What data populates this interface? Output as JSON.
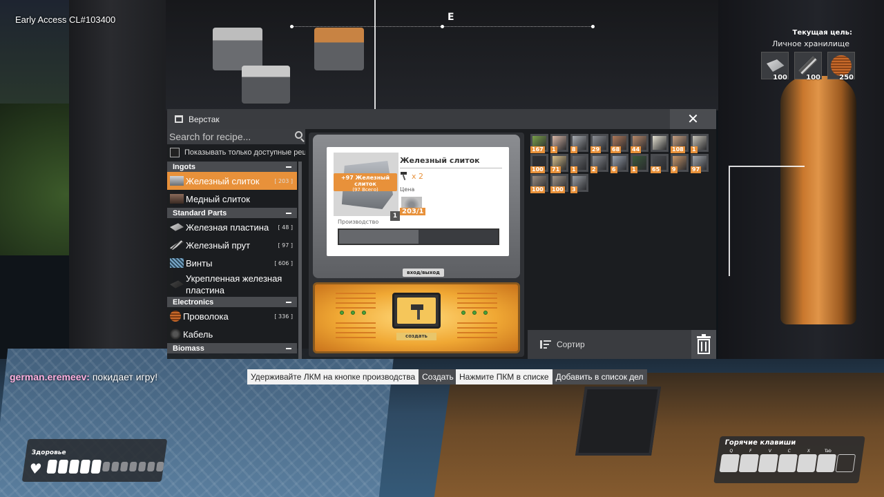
{
  "hud": {
    "build_label": "Early Access CL#103400",
    "compass_letter": "E",
    "goal_title": "Текущая цель:",
    "goal_subtitle": "Личное хранилище",
    "goal_items": [
      {
        "icon": "iron-plate-icon",
        "count": "100"
      },
      {
        "icon": "iron-rod-icon",
        "count": "100"
      },
      {
        "icon": "wire-icon",
        "count": "250"
      }
    ]
  },
  "window": {
    "title": "Верстак",
    "close_label": "✕",
    "search_placeholder": "Search for recipe...",
    "only_available_label": "Показывать только доступные рецепты"
  },
  "recipes": {
    "ingots_label": "Ingots",
    "standard_label": "Standard Parts",
    "electronics_label": "Electronics",
    "biomass_label": "Biomass",
    "items": {
      "iron_ingot": {
        "name": "Железный слиток",
        "count": "[ 203 ]"
      },
      "copper_ingot": {
        "name": "Медный слиток",
        "count": ""
      },
      "iron_plate": {
        "name": "Железная пластина",
        "count": "[ 48 ]"
      },
      "iron_rod": {
        "name": "Железный прут",
        "count": "[ 97 ]"
      },
      "screws": {
        "name": "Винты",
        "count": "[ 606 ]"
      },
      "reinforced_plate": {
        "name": "Укрепленная железная пластина",
        "count": ""
      },
      "wire": {
        "name": "Проволока",
        "count": "[ 336 ]"
      },
      "cable": {
        "name": "Кабель",
        "count": ""
      }
    }
  },
  "workbench": {
    "item_title": "Железный слиток",
    "badge_line1": "+97 Железный слиток",
    "badge_line2": "(97 Всего)",
    "hammer_multiplier": "x 2",
    "price_label": "Цена",
    "price_value": "203/1",
    "quantity": "1",
    "production_label": "Производство",
    "production_progress": 0.5,
    "io_label": "вход/выход",
    "craft_label": "создать"
  },
  "inventory": {
    "slots": [
      {
        "color": "#7aa04a",
        "count": "167"
      },
      {
        "color": "#d9b7a6",
        "count": "1"
      },
      {
        "color": "#a9adb2",
        "count": "8"
      },
      {
        "color": "#8d9096",
        "count": "29"
      },
      {
        "color": "#b07a5a",
        "count": "68"
      },
      {
        "color": "#b98a6a",
        "count": "44"
      },
      {
        "color": "#e6e2d2",
        "count": ""
      },
      {
        "color": "#c9a182",
        "count": "108"
      },
      {
        "color": "#c8c4b8",
        "count": "1"
      },
      {
        "color": "#2e3034",
        "count": "100"
      },
      {
        "color": "#d9c08a",
        "count": "71"
      },
      {
        "color": "#6c6e72",
        "count": "1"
      },
      {
        "color": "#8d9096",
        "count": "2"
      },
      {
        "color": "#9aa3b0",
        "count": "6"
      },
      {
        "color": "#3a5a3c",
        "count": "1"
      },
      {
        "color": "#4a4c50",
        "count": "65"
      },
      {
        "color": "#c9976a",
        "count": "9"
      },
      {
        "color": "#a0a4aa",
        "count": "97"
      },
      {
        "color": "#9a8c80",
        "count": "100"
      },
      {
        "color": "#a09488",
        "count": "100"
      },
      {
        "color": "#9a9ea4",
        "count": "3"
      }
    ],
    "sort_label": "Сортир"
  },
  "chat": {
    "player": "german.eremeev:",
    "message": "покидает игру!"
  },
  "hints": [
    {
      "key": "Удерживайте ЛКМ на кнопке производства",
      "value": "Создать"
    },
    {
      "key": "Нажмите ПКМ в списке",
      "value": "Добавить в список дел"
    }
  ],
  "health": {
    "label": "Здоровье",
    "filled": 5,
    "total": 12
  },
  "hotkeys": {
    "label": "Горячие клавиши",
    "keys": [
      "Q",
      "F",
      "V",
      "C",
      "X",
      "Tab",
      ""
    ]
  },
  "colors": {
    "accent": "#e8913a",
    "panel": "#3a3c40"
  }
}
